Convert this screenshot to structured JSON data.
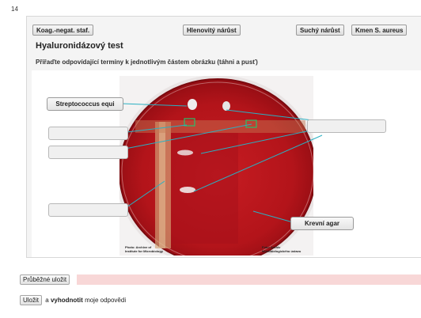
{
  "question": {
    "number": "14",
    "title": "Hyaluronidázový test",
    "instruction": "Přiřaďte odpovídající termíny k jednotlivým částem obrázku (táhni a pusť)"
  },
  "terms": [
    {
      "label": "Koag.-negat. staf."
    },
    {
      "label": "Hlenovitý nárůst"
    },
    {
      "label": "Suchý nárůst"
    },
    {
      "label": "Kmen S. aureus"
    }
  ],
  "drop_targets": [
    {
      "id": "1",
      "value": "Streptococcus equi"
    },
    {
      "id": "2",
      "value": ""
    },
    {
      "id": "3",
      "value": ""
    },
    {
      "id": "4",
      "value": ""
    },
    {
      "id": "5",
      "value": ""
    },
    {
      "id": "6",
      "value": "Krevní agar"
    }
  ],
  "image": {
    "credit_left": "Photo: Archive of\nInstitute for Microbiology",
    "credit_right": "Foto: Archiv\nMikrobiologického ústavu"
  },
  "buttons": {
    "interim_save": "Průběžné uložit",
    "save": "Uložit"
  },
  "submit_text": {
    "conjunction": "a",
    "evaluate": "vyhodnotit",
    "rest": "moje odpovědi"
  },
  "colors": {
    "connector": "#2ab0c2",
    "save_bar": "#f8d7d7",
    "agar": "#b5151a"
  }
}
